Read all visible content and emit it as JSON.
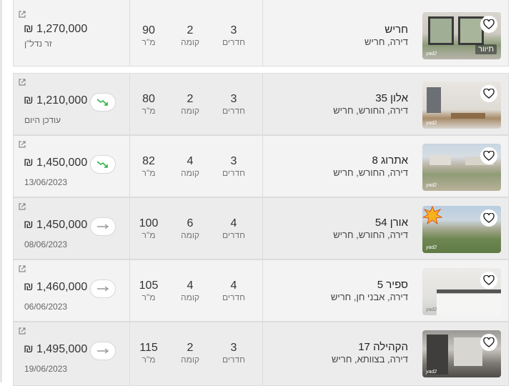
{
  "currency": "₪",
  "labels": {
    "rooms": "חדרים",
    "floor": "קומה",
    "area": "מ\"ר",
    "tour": "תיוור",
    "wm": "yad2"
  },
  "listings": [
    {
      "price": "1,270,000",
      "sub": "זר נדל\"ן",
      "trend": "none",
      "rooms": "3",
      "floor": "2",
      "area": "90",
      "title": "חריש",
      "address": "דירה, חריש",
      "tour": true
    },
    {
      "price": "1,210,000",
      "sub": "עודכן היום",
      "trend": "down",
      "rooms": "3",
      "floor": "2",
      "area": "80",
      "title": "אלון 35",
      "address": "דירה, החורש, חריש",
      "tour": false
    },
    {
      "price": "1,450,000",
      "sub": "13/06/2023",
      "trend": "down",
      "rooms": "3",
      "floor": "4",
      "area": "82",
      "title": "אתרוג 8",
      "address": "דירה, החורש, חריש",
      "tour": false
    },
    {
      "price": "1,450,000",
      "sub": "08/06/2023",
      "trend": "flat",
      "rooms": "4",
      "floor": "6",
      "area": "100",
      "title": "אורן 54",
      "address": "דירה, החורש, חריש",
      "tour": false
    },
    {
      "price": "1,460,000",
      "sub": "06/06/2023",
      "trend": "flat",
      "rooms": "4",
      "floor": "4",
      "area": "105",
      "title": "ספיר 5",
      "address": "דירה, אבני חן, חריש",
      "tour": false
    },
    {
      "price": "1,495,000",
      "sub": "19/06/2023",
      "trend": "flat",
      "rooms": "3",
      "floor": "2",
      "area": "115",
      "title": "הקהילה 17",
      "address": "דירה, בצוותא, חריש",
      "tour": false
    }
  ],
  "colors": {
    "trend_down": "#2fb344",
    "trend_flat": "#9a9a9a"
  }
}
